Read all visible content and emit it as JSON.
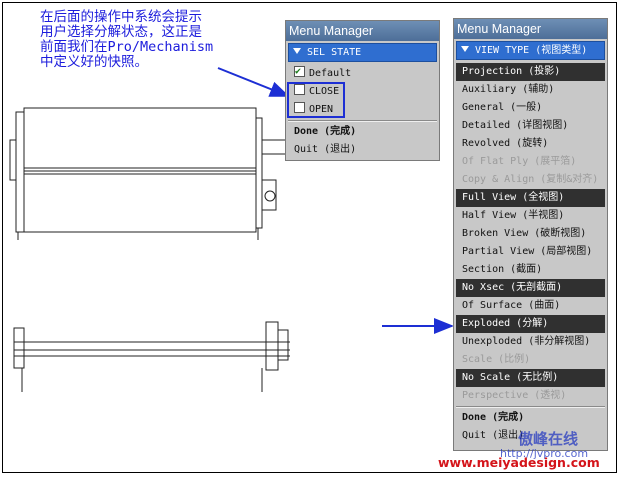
{
  "annotation": {
    "lines": [
      "在后面的操作中系统会提示",
      "用户选择分解状态，这正是",
      "前面我们在Pro/Mechanism",
      "中定义好的快照。"
    ]
  },
  "menu_left": {
    "title": "Menu Manager",
    "header": "SEL STATE",
    "items": [
      {
        "label": "Default"
      },
      {
        "label": "CLOSE"
      },
      {
        "label": "OPEN"
      },
      {
        "label": "Done (完成)"
      },
      {
        "label": "Quit (退出)"
      }
    ]
  },
  "menu_right": {
    "title": "Menu Manager",
    "header": "VIEW TYPE (视图类型)",
    "items": [
      {
        "label": "Projection (投影)"
      },
      {
        "label": "Auxiliary (辅助)"
      },
      {
        "label": "General (一般)"
      },
      {
        "label": "Detailed (详图视图)"
      },
      {
        "label": "Revolved (旋转)"
      },
      {
        "label": "Of Flat Ply (展平箔)"
      },
      {
        "label": "Copy & Align (复制&对齐)"
      },
      {
        "label": "Full View (全视图)"
      },
      {
        "label": "Half View (半视图)"
      },
      {
        "label": "Broken View (破断视图)"
      },
      {
        "label": "Partial View (局部视图)"
      },
      {
        "label": "Section (截面)"
      },
      {
        "label": "No Xsec (无剖截面)"
      },
      {
        "label": "Of Surface (曲面)"
      },
      {
        "label": "Exploded (分解)"
      },
      {
        "label": "Unexploded (非分解视图)"
      },
      {
        "label": "Scale (比例)"
      },
      {
        "label": "No Scale (无比例)"
      },
      {
        "label": "Perspective (透视)"
      },
      {
        "label": "Done (完成)"
      },
      {
        "label": "Quit (退出)"
      }
    ]
  },
  "watermark": {
    "cn": "傲峰在线",
    "url": "http://jvpro.com",
    "site": "www.meiyadesign.com"
  },
  "colors": {
    "annotation": "#1c1cdc",
    "selected_bg": "#303030",
    "header_bg": "#2f6ed0",
    "site_red": "#d4141a"
  }
}
